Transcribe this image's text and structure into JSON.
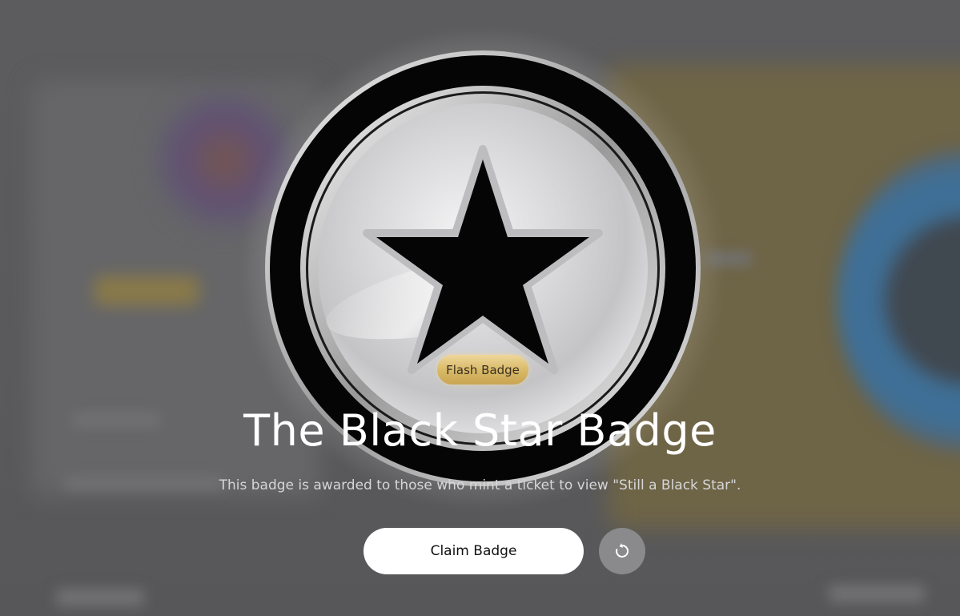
{
  "badge": {
    "tag_label": "Flash Badge",
    "title": "The Black Star Badge",
    "description": "This badge is awarded to those who mint a ticket to view \"Still a Black Star\".",
    "icon": "star-icon"
  },
  "actions": {
    "claim_label": "Claim Badge",
    "refresh_icon": "refresh-icon"
  },
  "colors": {
    "backdrop": "#5a5a5c",
    "badge_ring": "#050505",
    "badge_face": "#d9d9db",
    "tag_gold": "#d7b866",
    "claim_button_bg": "#ffffff",
    "refresh_button_bg": "#8a8a8c"
  }
}
